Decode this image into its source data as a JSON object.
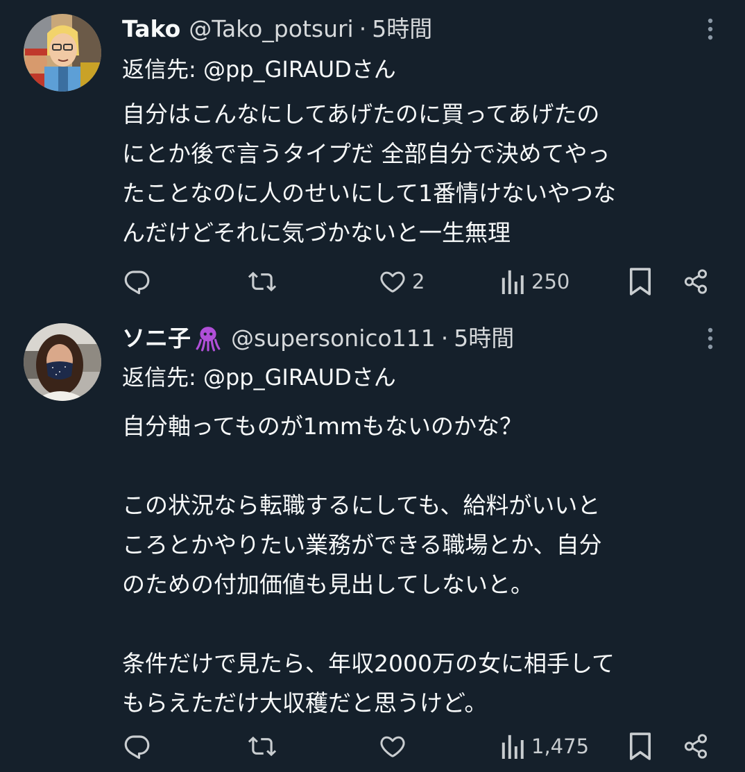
{
  "tweets": [
    {
      "display_name": "Tako",
      "handle": "@Tako_potsuri",
      "separator": "·",
      "time": "5時間",
      "reply_prefix": "返信先: ",
      "reply_mention": "@pp_GIRAUD",
      "reply_suffix": "さん",
      "body_lines": [
        "自分はこんなにしてあげたのに買ってあげたの",
        "にとか後で言うタイプだ 全部自分で決めてやっ",
        "たことなのに人のせいにして1番情けないやつな",
        "んだけどそれに気づかないと一生無理"
      ],
      "stats": {
        "replies": "",
        "retweets": "",
        "likes": "2",
        "views": "250"
      },
      "avatar_icon": "cartoon-avatar"
    },
    {
      "display_name": "ソニ子",
      "name_emoji": "octopus-emoji",
      "handle": "@supersonico111",
      "separator": "·",
      "time": "5時間",
      "reply_prefix": "返信先: ",
      "reply_mention": "@pp_GIRAUD",
      "reply_suffix": "さん",
      "body_lines": [
        "自分軸ってものが1mmもないのかな？",
        "",
        "この状況なら転職するにしても、給料がいいと",
        "ころとかやりたい業務ができる職場とか、自分",
        "のための付加価値も見出してしないと。",
        "",
        "条件だけで見たら、年収2000万の女に相手して",
        "もらえただけ大収穫だと思うけど。"
      ],
      "stats": {
        "replies": "",
        "retweets": "",
        "likes": "",
        "views": "1,475"
      },
      "avatar_icon": "photo-avatar"
    }
  ],
  "colors": {
    "background": "#15202b",
    "text": "#f7f9f9",
    "secondary": "#c9cdd0",
    "emoji": "#b04fd8"
  }
}
